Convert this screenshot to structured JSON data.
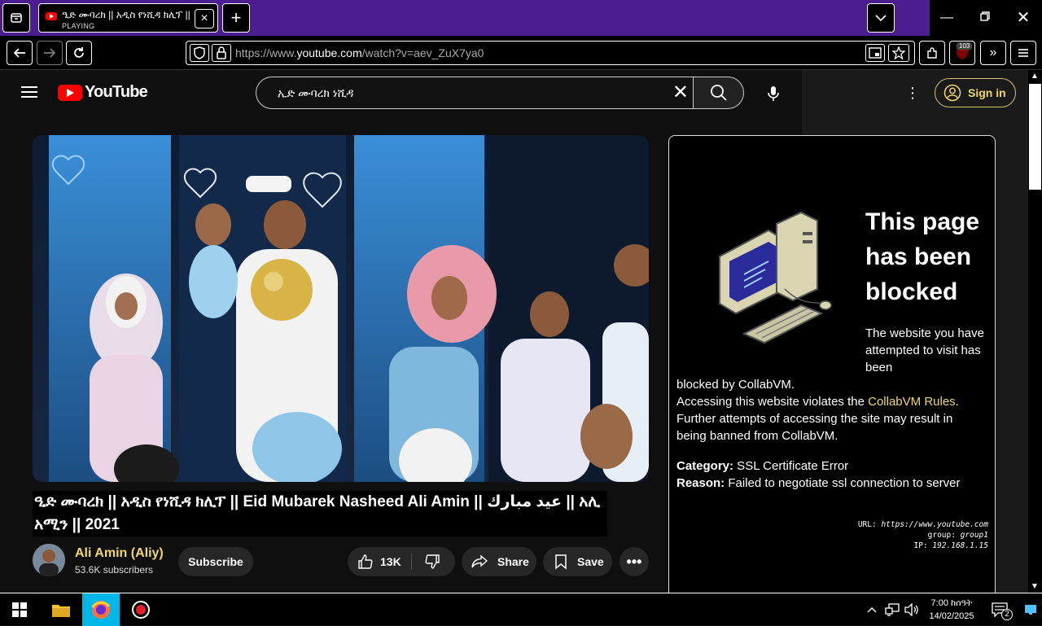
{
  "browser": {
    "tab_title": "ዒድ ሙባረክ || አዲስ የነሺዳ ክሊፕ || Eid Mubarek",
    "tab_status": "PLAYING",
    "url_prefix": "https://www.",
    "url_domain": "youtube.com",
    "url_path": "/watch?v=aev_ZuX7ya0",
    "extension_badge": "103"
  },
  "youtube": {
    "logo_text": "YouTube",
    "search_query": "ኢድ ሙባረክ ነሺዳ",
    "sign_in_label": "Sign in",
    "video_title": "ዒድ ሙባረክ || አዲስ የነሺዳ ክሊፕ || Eid Mubarek Nasheed Ali Amin || عيد مبارك || አሊ አሚን || 2021",
    "channel_name": "Ali Amin (Aliy)",
    "subscribers": "53.6K subscribers",
    "subscribe_label": "Subscribe",
    "likes": "13K",
    "share_label": "Share",
    "save_label": "Save"
  },
  "block_page": {
    "heading": "This page has been blocked",
    "para1": "The website you have attempted to visit has been",
    "para2_a": "blocked by CollabVM.",
    "para2_b": "Accessing this website violates the ",
    "rules_link": "CollabVM Rules",
    "para2_c": ". Further attempts of accessing the site may result in being banned from CollabVM.",
    "category_label": "Category:",
    "category_value": " SSL Certificate Error",
    "reason_label": "Reason:",
    "reason_value": " Failed to negotiate ssl connection to server",
    "url_label": "URL: ",
    "url_value": "https://www.youtube.com",
    "group_label": "group: ",
    "group_value": "group1",
    "ip_label": "IP: ",
    "ip_value": "192.168.1.15"
  },
  "taskbar": {
    "time": "7:00 ከሰዓት",
    "date": "14/02/2025",
    "notifications": "2"
  },
  "colors": {
    "titlebar": "#4b1d8f",
    "accent_yellow": "#f0d96a",
    "youtube_red": "#ff0000"
  }
}
